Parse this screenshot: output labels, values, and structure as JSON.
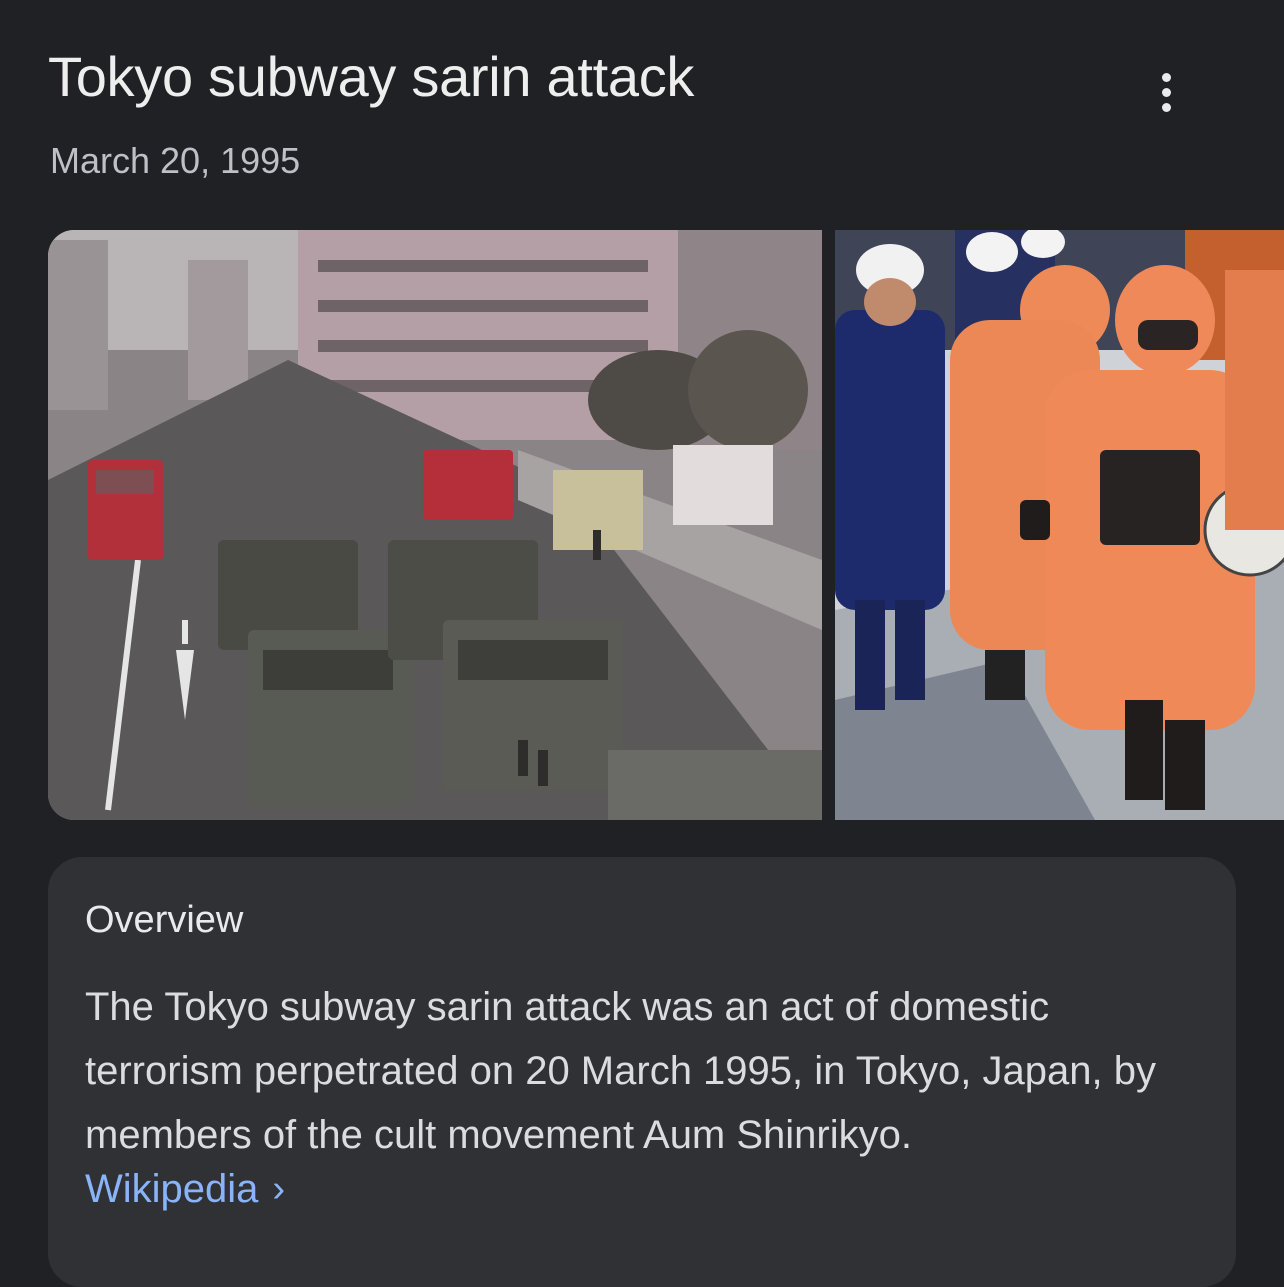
{
  "header": {
    "title": "Tokyo subway sarin attack",
    "date": "March 20, 1995",
    "more_icon": "more-vert-icon"
  },
  "images": [
    {
      "name": "street-photo"
    },
    {
      "name": "hazmat-photo"
    }
  ],
  "overview": {
    "heading": "Overview",
    "body": "The Tokyo subway sarin attack was an act of domestic terrorism perpetrated on 20 March 1995, in Tokyo, Japan, by members of the cult movement Aum Shinrikyo.",
    "source_link": "Wikipedia",
    "source_chevron": "›"
  },
  "colors": {
    "background": "#202124",
    "card": "#303134",
    "link": "#8ab4f8",
    "text": "#e8eaed"
  }
}
